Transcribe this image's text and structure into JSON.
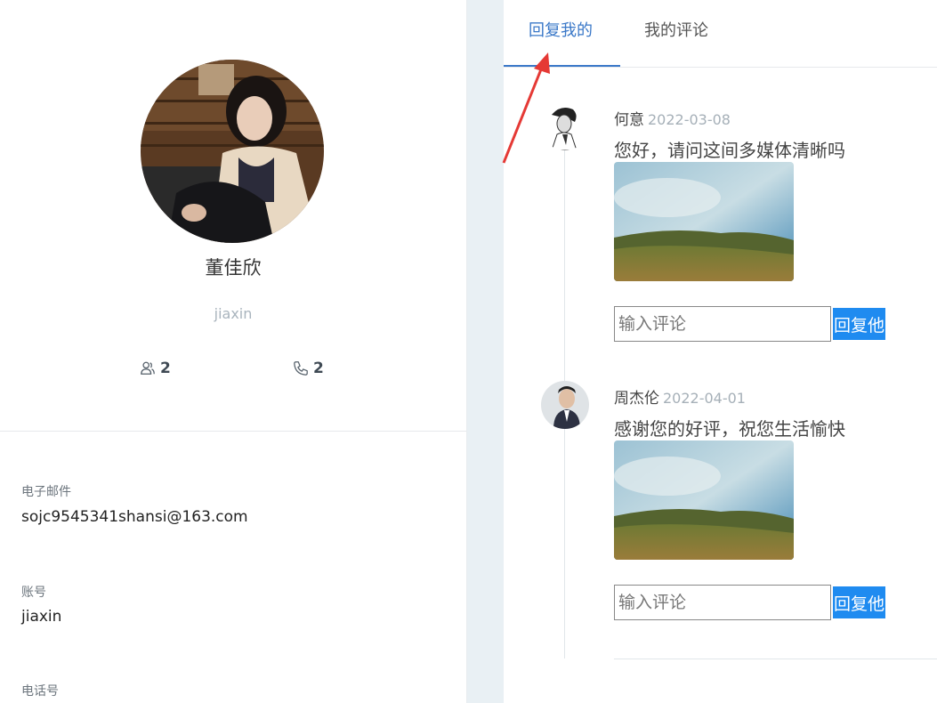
{
  "profile": {
    "name": "董佳欣",
    "handle": "jiaxin",
    "stats": {
      "followers": "2",
      "calls": "2"
    },
    "fields": [
      {
        "label": "电子邮件",
        "value": "sojc9545341shansi@163.com"
      },
      {
        "label": "账号",
        "value": "jiaxin"
      },
      {
        "label": "电话号",
        "value": ""
      }
    ]
  },
  "tabs": [
    {
      "label": "回复我的",
      "active": true
    },
    {
      "label": "我的评论",
      "active": false
    }
  ],
  "comments": [
    {
      "author": "何意",
      "date": "2022-03-08",
      "text": "您好，请问这间多媒体清晰吗",
      "input_placeholder": "输入评论",
      "reply_label": "回复他"
    },
    {
      "author": "周杰伦",
      "date": "2022-04-01",
      "text": "感谢您的好评，祝您生活愉快",
      "input_placeholder": "输入评论",
      "reply_label": "回复他"
    }
  ],
  "colors": {
    "accent": "#3a78c8",
    "button": "#1f8bf0",
    "annotation_arrow": "#e53935"
  }
}
